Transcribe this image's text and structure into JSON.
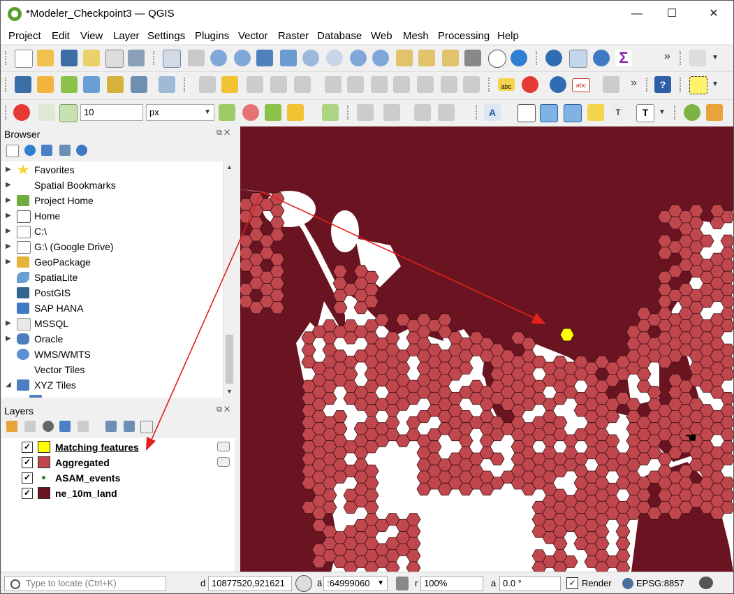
{
  "window": {
    "title": "*Modeler_Checkpoint3 — QGIS",
    "minimize_glyph": "—",
    "maximize_glyph": "☐",
    "close_glyph": "✕"
  },
  "menu": [
    "Project",
    "Edit",
    "View",
    "Layer",
    "Settings",
    "Plugins",
    "Vector",
    "Raster",
    "Database",
    "Web",
    "Mesh",
    "Processing",
    "Help"
  ],
  "snapping": {
    "tolerance_value": "10",
    "units_value": "px"
  },
  "toolbar": {
    "overflow_glyph": "»"
  },
  "browser": {
    "title": "Browser",
    "items": [
      {
        "label": "Favorites",
        "icon": "star-icon",
        "expandable": true
      },
      {
        "label": "Spatial Bookmarks",
        "icon": "bookmark-icon",
        "expandable": true
      },
      {
        "label": "Project Home",
        "icon": "project-home-icon",
        "expandable": true
      },
      {
        "label": "Home",
        "icon": "home-icon",
        "expandable": true
      },
      {
        "label": "C:\\",
        "icon": "folder-icon",
        "expandable": true
      },
      {
        "label": "G:\\ (Google Drive)",
        "icon": "folder-icon",
        "expandable": true
      },
      {
        "label": "GeoPackage",
        "icon": "geopackage-icon",
        "expandable": true
      },
      {
        "label": "SpatiaLite",
        "icon": "spatialite-icon",
        "expandable": false
      },
      {
        "label": "PostGIS",
        "icon": "postgis-icon",
        "expandable": false
      },
      {
        "label": "SAP HANA",
        "icon": "sap-hana-icon",
        "expandable": false
      },
      {
        "label": "MSSQL",
        "icon": "mssql-icon",
        "expandable": true
      },
      {
        "label": "Oracle",
        "icon": "oracle-icon",
        "expandable": true
      },
      {
        "label": "WMS/WMTS",
        "icon": "wms-icon",
        "expandable": false
      },
      {
        "label": "Vector Tiles",
        "icon": "vector-tiles-icon",
        "expandable": false
      },
      {
        "label": "XYZ Tiles",
        "icon": "xyz-tiles-icon",
        "expandable": true,
        "expanded": true
      }
    ]
  },
  "layers": {
    "title": "Layers",
    "items": [
      {
        "label": "Matching features",
        "checked": true,
        "color": "#ffff00",
        "underlined": true
      },
      {
        "label": "Aggregated",
        "checked": true,
        "color": "#c0474d"
      },
      {
        "label": "ASAM_events",
        "checked": true,
        "color": "#2e7d32",
        "point": true
      },
      {
        "label": "ne_10m_land",
        "checked": true,
        "color": "#6a1422"
      }
    ]
  },
  "colors": {
    "land": "#6a1422",
    "hexagon_fill": "#c0474d",
    "hexagon_stroke": "#3a1010",
    "selected_hexagon": "#ffff00",
    "arrow": "#e3201b",
    "checkmark": "✓"
  },
  "status": {
    "locator_placeholder": "Type to locate (Ctrl+K)",
    "coordinate": "10877520,921621",
    "scale": ":64999060",
    "magnifier": "100%",
    "rotation": "0.0 °",
    "render_label": "Render",
    "crs": "EPSG:8857",
    "coordinate_prefix": "d",
    "scale_prefix": "ä",
    "magnifier_prefix": "r",
    "rotation_prefix": "a"
  }
}
